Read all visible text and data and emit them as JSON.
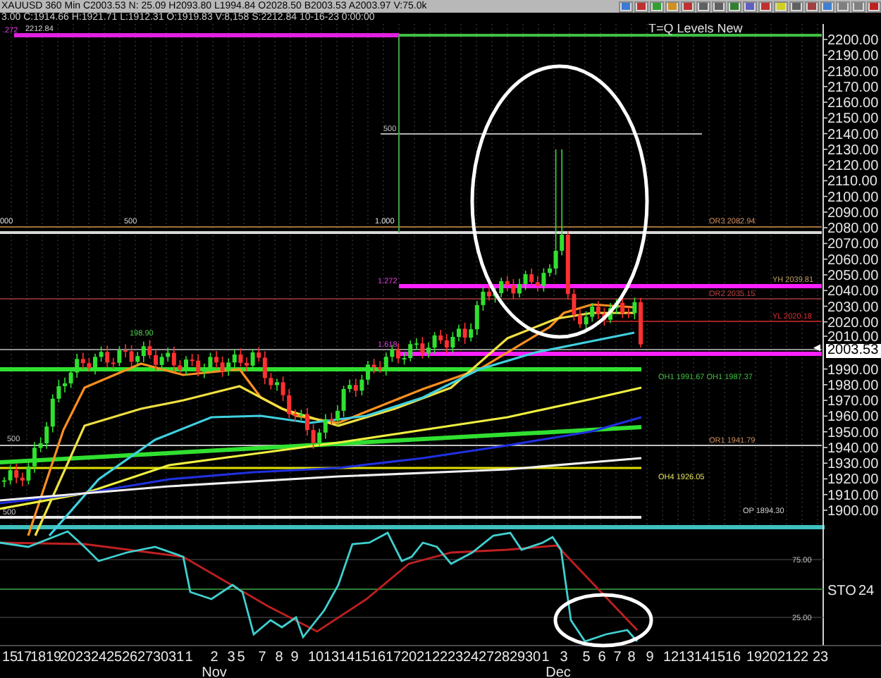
{
  "header": {
    "quote_line": "XAUUSD 360 Min C2003.53 N: 25.09 H2093.80 L1994.84 O2028.50 B2003.53 A2003.97 V:75.0k",
    "bar_info": "3.00 C:1914.66 H:1921.71 L:1912.31 O:1919.83 V:8,158 S:2212.84 10-16-23 0:00:00"
  },
  "price_pane": {
    "title": "T=Q Levels New",
    "y_axis": [
      "2200.00",
      "2190.00",
      "2180.00",
      "2170.00",
      "2160.00",
      "2150.00",
      "2140.00",
      "2130.00",
      "2120.00",
      "2110.00",
      "2100.00",
      "2090.00",
      "2080.00",
      "2070.00",
      "2060.00",
      "2050.00",
      "2040.00",
      "2030.00",
      "2020.00",
      "2010.00",
      "1990.00",
      "1980.00",
      "1970.00",
      "1960.00",
      "1950.00",
      "1940.00",
      "1930.00",
      "1920.00",
      "1910.00",
      "1900.00"
    ],
    "current_price": "2003.53",
    "level_labels": [
      "2212.84",
      ".272",
      "500",
      "000",
      "500",
      "1.000",
      "OR3 2082.94",
      "1.272",
      "YH 2039.81",
      "OR2 2035.15",
      "YL 2020.18",
      "198.90",
      "1.618",
      "OH1 1991.67 OH1 1987.37",
      "500",
      "OR1 1941.79",
      "OH4 1926.05",
      "OP 1894.30",
      "500"
    ]
  },
  "indicator_pane": {
    "name": "STO",
    "value": "24",
    "y_labels": [
      "75.00",
      "25.00"
    ]
  },
  "x_axis": {
    "days": [
      "15",
      "17",
      "18",
      "19",
      "20",
      "23",
      "24",
      "25",
      "26",
      "27",
      "30",
      "31",
      "1",
      "2",
      "3",
      "5",
      "7",
      "8",
      "9",
      "10",
      "13",
      "14",
      "15",
      "16",
      "17",
      "20",
      "21",
      "22",
      "23",
      "24",
      "27",
      "28",
      "29",
      "30",
      "1",
      "3",
      "5",
      "6",
      "7",
      "8",
      "9",
      "12",
      "13",
      "14",
      "15",
      "16",
      "19",
      "20",
      "21",
      "22",
      "23"
    ],
    "months": [
      "Nov",
      "Dec"
    ]
  }
}
